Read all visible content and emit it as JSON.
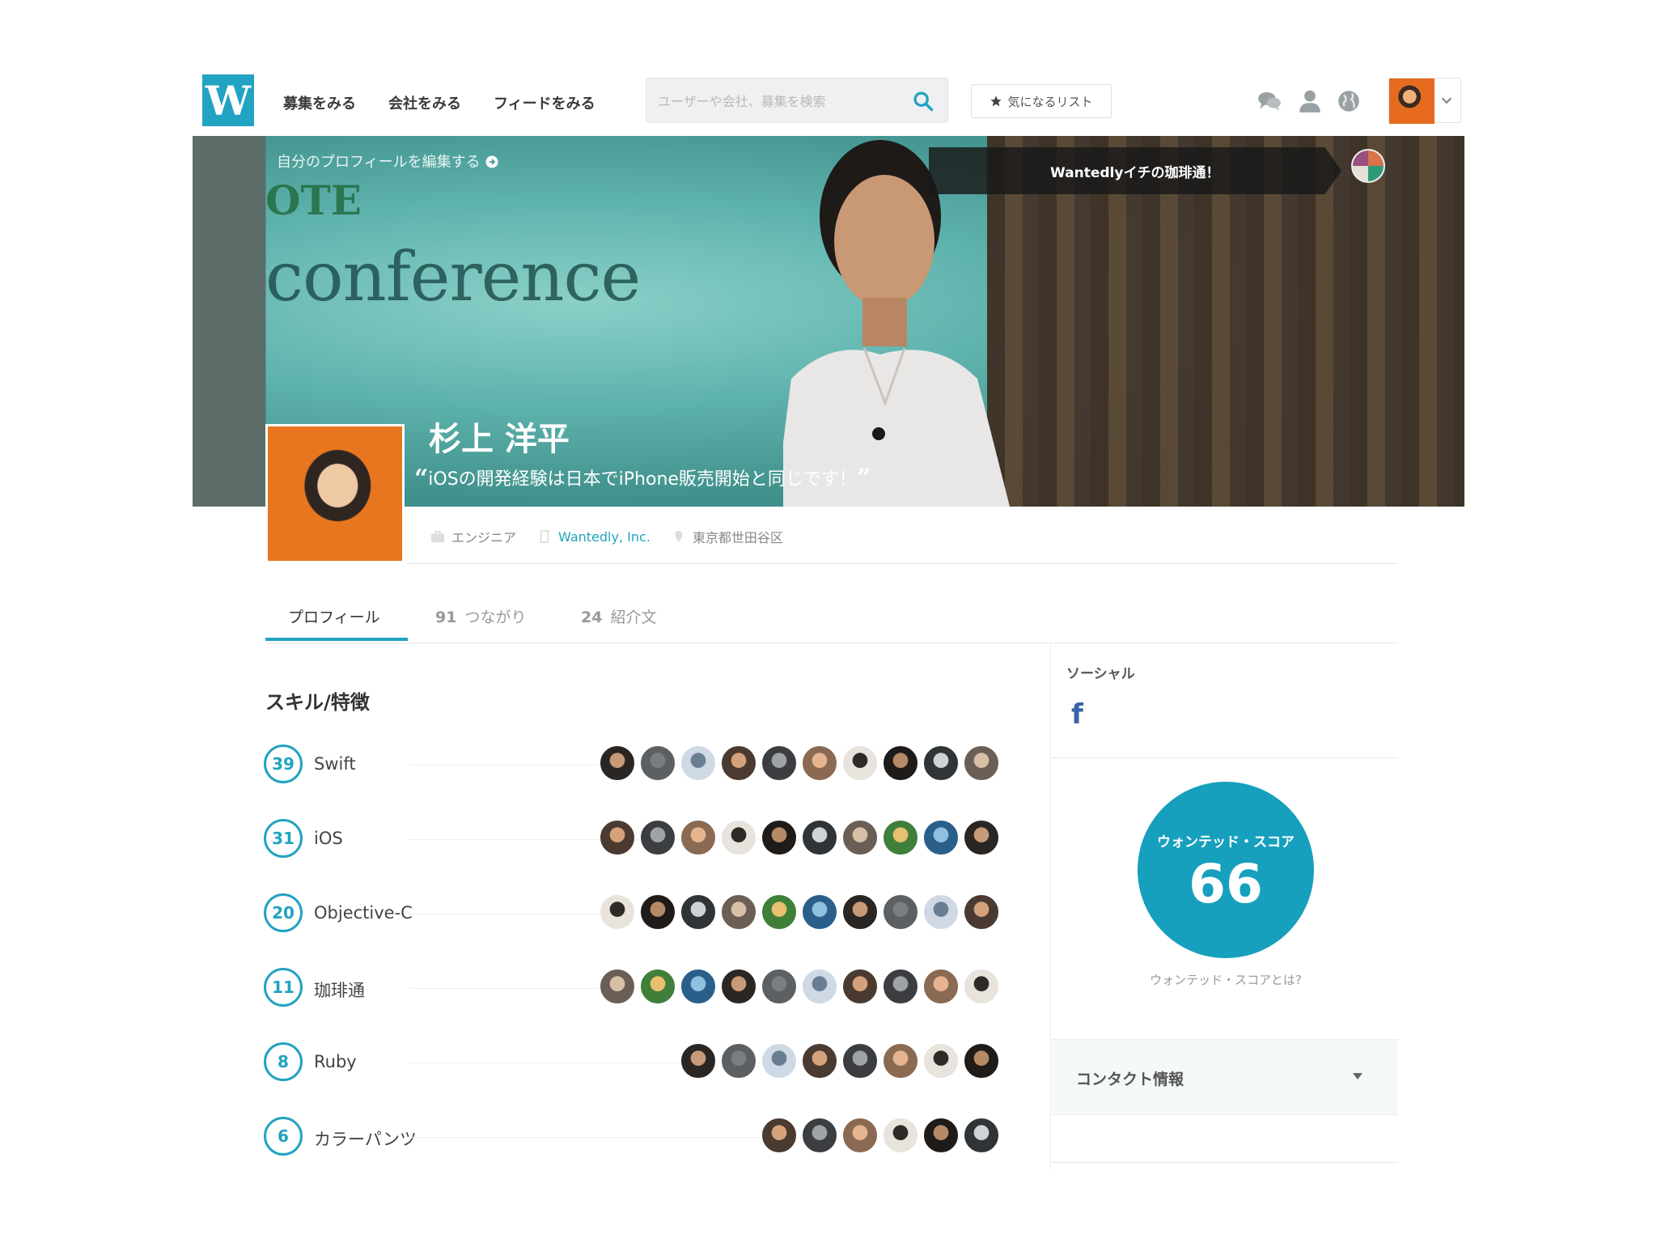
{
  "header": {
    "logo": "W",
    "nav": [
      "募集をみる",
      "会社をみる",
      "フィードをみる"
    ],
    "search_placeholder": "ユーザーや会社、募集を検索",
    "favorites_label": "気になるリスト"
  },
  "cover": {
    "edit_link": "自分のプロフィールを編集する",
    "notice": "Wantedlyイチの珈琲通！",
    "background_text_top": "OTE",
    "background_text": "conference",
    "name": "杉上 洋平",
    "quote": "iOSの開発経験は日本でiPhone販売開始と同じです！"
  },
  "meta": {
    "role": "エンジニア",
    "company": "Wantedly, Inc.",
    "location": "東京都世田谷区"
  },
  "tabs": [
    {
      "count": "",
      "label": "プロフィール"
    },
    {
      "count": "91",
      "label": "つながり"
    },
    {
      "count": "24",
      "label": "紹介文"
    }
  ],
  "skills": {
    "title": "スキル/特徴",
    "items": [
      {
        "count": "39",
        "name": "Swift",
        "endorsers": 10
      },
      {
        "count": "31",
        "name": "iOS",
        "endorsers": 10
      },
      {
        "count": "20",
        "name": "Objective-C",
        "endorsers": 10
      },
      {
        "count": "11",
        "name": "珈琲通",
        "endorsers": 10
      },
      {
        "count": "8",
        "name": "Ruby",
        "endorsers": 8
      },
      {
        "count": "6",
        "name": "カラーパンツ",
        "endorsers": 6
      }
    ]
  },
  "sidebar": {
    "social_title": "ソーシャル",
    "facebook": "f",
    "score_label": "ウォンテッド・スコア",
    "score_value": "66",
    "score_link": "ウォンテッド・スコアとは?",
    "contact_title": "コンタクト情報"
  },
  "colors": {
    "accent": "#21a3c1",
    "score": "#16a0bd",
    "facebook": "#3b62a8"
  }
}
